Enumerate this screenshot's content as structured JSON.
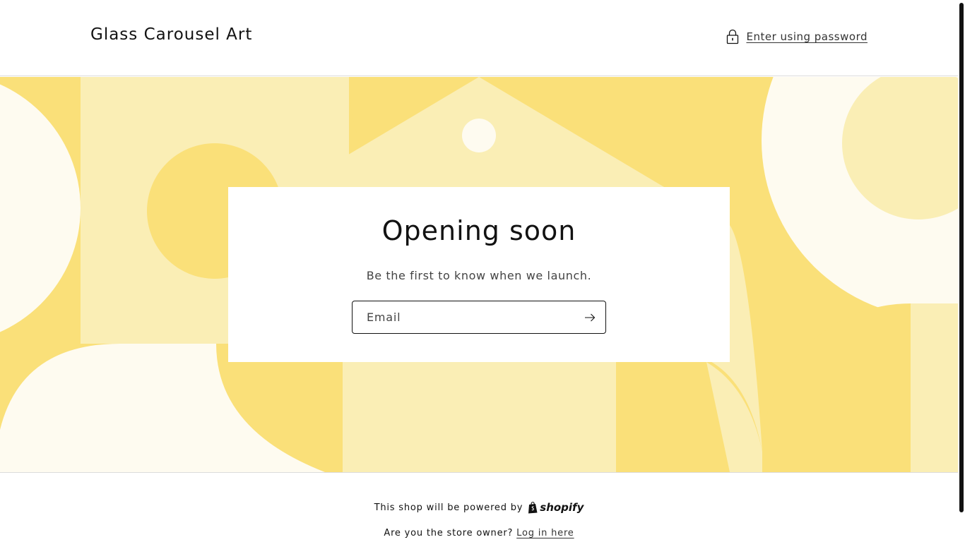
{
  "header": {
    "store_title": "Glass Carousel Art",
    "password_link": "Enter using password",
    "lock_icon": "lock-icon"
  },
  "banner": {
    "colors": {
      "base": "#fae079",
      "light": "#faeeb5",
      "lightest": "#fefbf0"
    }
  },
  "card": {
    "heading": "Opening soon",
    "subtext": "Be the first to know when we launch.",
    "email_placeholder": "Email",
    "submit_icon": "arrow-right-icon"
  },
  "footer": {
    "powered_by": "This shop will be powered by",
    "shopify_wordmark": "shopify",
    "owner_question": "Are you the store owner?",
    "login_link": "Log in here"
  }
}
